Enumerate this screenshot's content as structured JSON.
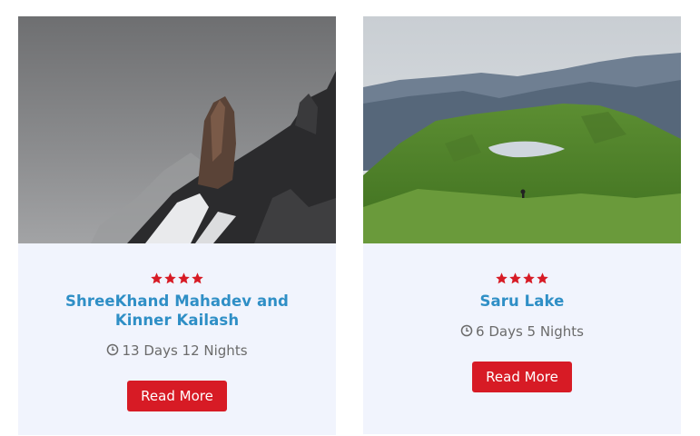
{
  "colors": {
    "accent": "#d71b25",
    "title": "#2f8fc6",
    "card_bg": "#f1f4fd",
    "meta": "#6b6b6b"
  },
  "cards": [
    {
      "image": "foggy-rocky-peak-with-snow",
      "rating": 4,
      "title": "ShreeKhand Mahadev and Kinner Kailash",
      "duration": "13 Days 12 Nights",
      "button": "Read More",
      "icons": {
        "star": "star-icon",
        "clock": "clock-icon"
      }
    },
    {
      "image": "green-meadow-with-lake-and-mountains",
      "rating": 4,
      "title": "Saru Lake",
      "duration": "6 Days 5 Nights",
      "button": "Read More",
      "icons": {
        "star": "star-icon",
        "clock": "clock-icon"
      }
    }
  ]
}
